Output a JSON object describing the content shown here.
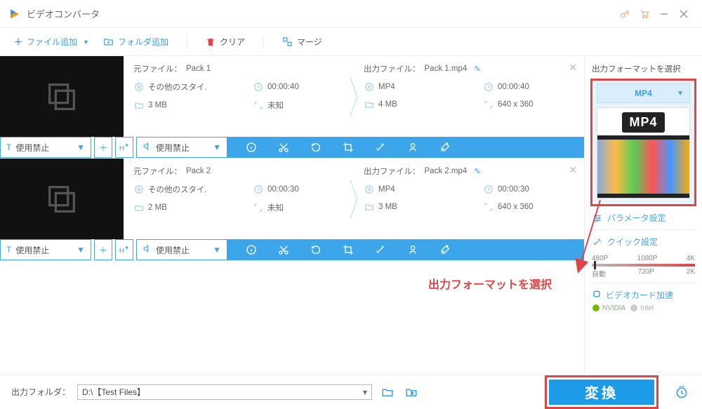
{
  "app": {
    "title": "ビデオコンバータ"
  },
  "toolbar": {
    "add_file": "ファイル追加",
    "add_folder": "フォルダ追加",
    "clear": "クリア",
    "merge": "マージ"
  },
  "items": [
    {
      "src_label": "元ファイル：",
      "src_name": "Pack 1",
      "src_style": "その他のスタイ.",
      "src_duration": "00:00:40",
      "src_size": "3 MB",
      "src_dim": "未知",
      "out_label": "出力ファイル：",
      "out_name": "Pack 1.mp4",
      "out_format": "MP4",
      "out_duration": "00:00:40",
      "out_size": "4 MB",
      "out_dim": "640 x 360",
      "subtitle": "使用禁止",
      "audio": "使用禁止"
    },
    {
      "src_label": "元ファイル：",
      "src_name": "Pack 2",
      "src_style": "その他のスタイ.",
      "src_duration": "00:00:30",
      "src_size": "2 MB",
      "src_dim": "未知",
      "out_label": "出力ファイル：",
      "out_name": "Pack 2.mp4",
      "out_format": "MP4",
      "out_duration": "00:00:30",
      "out_size": "3 MB",
      "out_dim": "640 x 360",
      "subtitle": "使用禁止",
      "audio": "使用禁止"
    }
  ],
  "sidebar": {
    "title": "出力フォーマットを選択",
    "format": "MP4",
    "badge": "MP4",
    "param": "パラメータ設定",
    "quick": "クイック設定",
    "q_top": [
      "480P",
      "1080P",
      "4K"
    ],
    "q_bot": [
      "自動",
      "720P",
      "2K"
    ],
    "gpu": "ビデオカード加速",
    "nvidia": "NVIDIA",
    "intel": "Intel"
  },
  "annotation": {
    "text": "出力フォーマットを選択"
  },
  "footer": {
    "label": "出力フォルダ：",
    "path": "D:\\【Test Files】",
    "convert": "変換"
  }
}
